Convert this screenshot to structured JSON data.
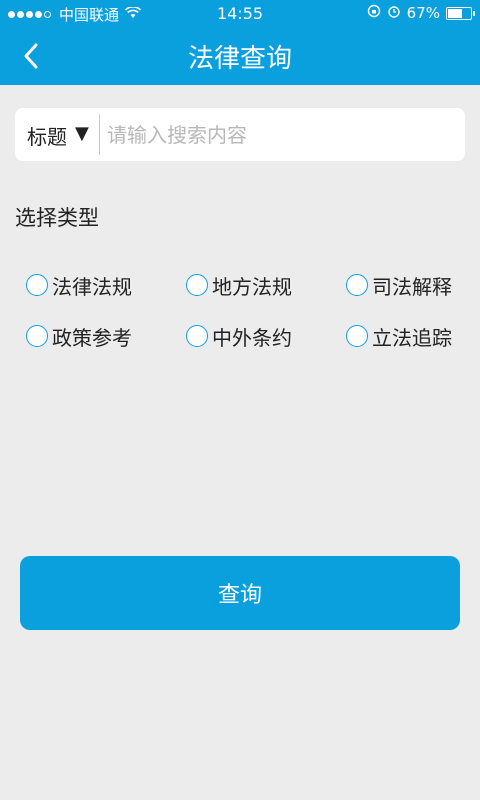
{
  "status_bar": {
    "carrier": "中国联通",
    "time": "14:55",
    "battery": "67%",
    "battery_level": 0.67
  },
  "navbar": {
    "title": "法律查询",
    "back_icon": "chevron-left-icon"
  },
  "search": {
    "type_label": "标题",
    "type_arrow": "▼",
    "placeholder": "请输入搜索内容",
    "value": ""
  },
  "section": {
    "title": "选择类型"
  },
  "types": [
    {
      "label": "法律法规",
      "checked": false
    },
    {
      "label": "地方法规",
      "checked": false
    },
    {
      "label": "司法解释",
      "checked": false
    },
    {
      "label": "政策参考",
      "checked": false
    },
    {
      "label": "中外条约",
      "checked": false
    },
    {
      "label": "立法追踪",
      "checked": false
    }
  ],
  "button": {
    "query_label": "查询"
  },
  "colors": {
    "primary": "#0aa0de",
    "background": "#ececec"
  }
}
